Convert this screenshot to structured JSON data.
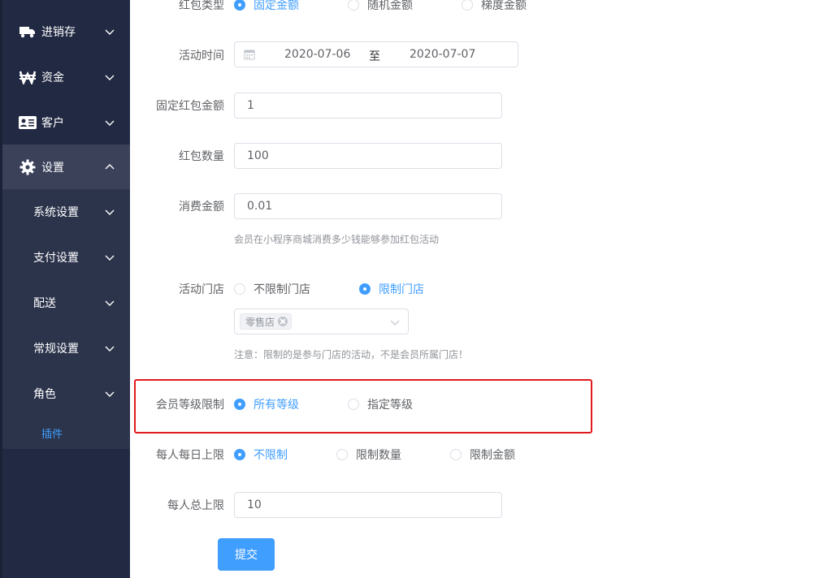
{
  "sidebar": {
    "items": [
      {
        "label": "进销存",
        "icon": "truck-icon"
      },
      {
        "label": "资金",
        "icon": "won-currency-icon"
      },
      {
        "label": "客户",
        "icon": "id-card-icon"
      },
      {
        "label": "设置",
        "icon": "gear-icon"
      }
    ],
    "submenu": [
      {
        "label": "系统设置"
      },
      {
        "label": "支付设置"
      },
      {
        "label": "配送"
      },
      {
        "label": "常规设置"
      },
      {
        "label": "角色"
      }
    ],
    "active_leaf": "插件",
    "accent_color": "#409eff"
  },
  "form": {
    "packet_type": {
      "label": "红包类型",
      "options": [
        "固定金额",
        "随机金额",
        "梯度金额"
      ],
      "selected": "固定金额"
    },
    "activity_time": {
      "label": "活动时间",
      "start": "2020-07-06",
      "separator": "至",
      "end": "2020-07-07"
    },
    "fixed_amount": {
      "label": "固定红包金额",
      "value": "1"
    },
    "packet_count": {
      "label": "红包数量",
      "value": "100"
    },
    "spend_amount": {
      "label": "消费金额",
      "value": "0.01",
      "hint": "会员在小程序商城消费多少钱能够参加红包活动"
    },
    "stores": {
      "label": "活动门店",
      "options": [
        "不限制门店",
        "限制门店"
      ],
      "selected": "限制门店",
      "selected_tag": "零售店",
      "hint": "注意：限制的是参与门店的活动，不是会员所属门店！"
    },
    "member_level": {
      "label": "会员等级限制",
      "options": [
        "所有等级",
        "指定等级"
      ],
      "selected": "所有等级"
    },
    "daily_limit": {
      "label": "每人每日上限",
      "options": [
        "不限制",
        "限制数量",
        "限制金额"
      ],
      "selected": "不限制"
    },
    "total_limit": {
      "label": "每人总上限",
      "value": "10"
    },
    "submit_label": "提交"
  },
  "colors": {
    "sidebar_bg": "#222a43",
    "highlight_border": "#e0191d",
    "primary": "#409eff"
  }
}
